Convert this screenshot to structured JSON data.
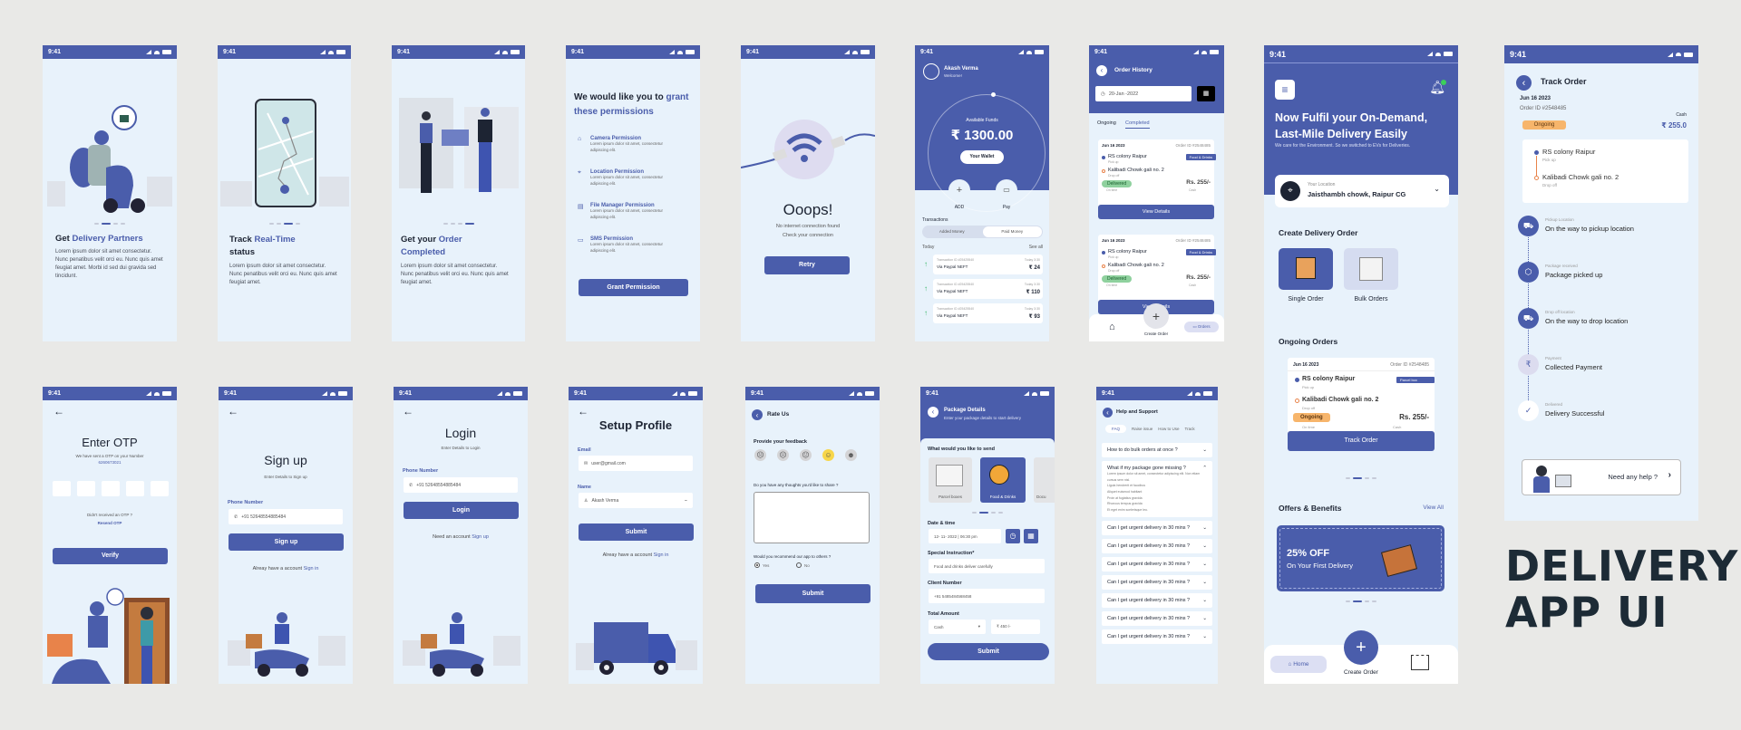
{
  "status_time": "9:41",
  "brand_title": [
    "DELIVERY",
    "APP UI"
  ],
  "colors": {
    "primary": "#4a5dab",
    "screen_bg": "#e8f2fb",
    "page_bg": "#e9e9e7",
    "ongoing": "#f7b56b",
    "delivered": "#8fd19e"
  },
  "onboarding": [
    {
      "title_plain": "Get ",
      "title_accent": "Delivery Partners",
      "body": "Lorem ipsum dolor sit amet consectetur. Nunc penatibus velit orci eu. Nunc quis amet feugiat amet. Morbi id sed dui gravida sed tincidunt."
    },
    {
      "title_plain": "Track ",
      "title_accent": "Real-Time",
      "title_tail": "status",
      "body": "Lorem ipsum dolor sit amet consectetur. Nunc penatibus velit orci eu. Nunc quis amet feugiat amet."
    },
    {
      "title_plain": "Get your ",
      "title_accent": "Order Completed",
      "body": "Lorem ipsum dolor sit amet consectetur. Nunc penatibus velit orci eu. Nunc quis amet feugiat amet."
    }
  ],
  "permissions": {
    "title_plain": "We would like you to ",
    "title_accent": "grant these permissions",
    "items": [
      {
        "icon": "camera-icon",
        "title": "Camera Permission",
        "desc": "Lorem ipsum dolor sit amet, consectetur adipiscing elit."
      },
      {
        "icon": "location-icon",
        "title": "Location Permission",
        "desc": "Lorem ipsum dolor sit amet, consectetur adipiscing elit."
      },
      {
        "icon": "file-icon",
        "title": "File Manager Permission",
        "desc": "Lorem ipsum dolor sit amet, consectetur adipiscing elit."
      },
      {
        "icon": "sms-icon",
        "title": "SMS Permission",
        "desc": "Lorem ipsum dolor sit amet, consectetur adipiscing elit."
      }
    ],
    "button": "Grant Permission"
  },
  "no_internet": {
    "title": "Ooops!",
    "line1": "No internet connection found",
    "line2": "Check your connection",
    "button": "Retry"
  },
  "wallet": {
    "user": "Akash Verma",
    "greeting": "Welcome!",
    "funds_label": "Available Funds",
    "amount": "₹ 1300.00",
    "wallet_btn": "Your Wallet",
    "add": "ADD",
    "pay": "Pay",
    "transactions_label": "Transactions",
    "tabs": [
      "Added Money",
      "Paid Money"
    ],
    "today": "Today",
    "see_all": "See all",
    "items": [
      {
        "id": "Transaction ID #25425540",
        "via": "Via Paypal NEFT",
        "time": "Today 3:30",
        "amount": "₹ 24"
      },
      {
        "id": "Transaction ID #25425540",
        "via": "Via Paypal NEFT",
        "time": "Today 3:30",
        "amount": "₹ 110"
      },
      {
        "id": "Transaction ID #25425540",
        "via": "Via Paypal NEFT",
        "time": "Today 3:30",
        "amount": "₹ 93"
      }
    ]
  },
  "order_history": {
    "title": "Order History",
    "date": "20-Jan -2022",
    "tabs": [
      "Ongoing",
      "Completed"
    ],
    "orders": [
      {
        "date": "Jun 16 2023",
        "order_id": "Order ID #2548485",
        "tag": "Food & Drinks",
        "pickup": "RS colony Raipur",
        "pickup_label": "Pick up",
        "drop": "Kalibadi Chowk gali no. 2",
        "drop_label": "Drop off",
        "status": "Delivered",
        "status_sub": "On time",
        "price": "Rs. 255/-",
        "pay": "Cash",
        "button": "View Details"
      },
      {
        "date": "Jun 16 2023",
        "order_id": "Order ID #2548485",
        "tag": "Food & Drinks",
        "pickup": "RS colony Raipur",
        "pickup_label": "Pick up",
        "drop": "Kalibadi Chowk gali no. 2",
        "drop_label": "Drop off",
        "status": "Delivered",
        "status_sub": "On time",
        "price": "Rs. 255/-",
        "pay": "Cash",
        "button": "View Details"
      }
    ],
    "nav": {
      "create": "Create Order",
      "orders": "Orders"
    }
  },
  "home": {
    "headline": "Now Fulfil your On-Demand, Last-Mile Delivery Easily",
    "sub": "We care for the Environment. So we switched to EVs for Deliveries.",
    "location_label": "Your Location",
    "location": "Jaisthambh chowk, Raipur CG",
    "create_title": "Create Delivery Order",
    "single": "Single Order",
    "bulk": "Bulk Orders",
    "ongoing_title": "Ongoing Orders",
    "order": {
      "date": "Jun 16 2023",
      "order_id": "Order ID #2548485",
      "tag": "Parcel box",
      "pickup": "RS colony Raipur",
      "pickup_label": "Pick up",
      "drop": "Kalibadi Chowk gali no. 2",
      "drop_label": "Drop off",
      "status": "Ongoing",
      "status_sub": "On time",
      "price": "Rs. 255/-",
      "pay": "Cash",
      "button": "Track Order"
    },
    "offers_title": "Offers & Benefits",
    "view_all": "View All",
    "offer_big": "25% OFF",
    "offer_small": "On Your First Delivery",
    "nav": {
      "home": "Home",
      "create": "Create Order"
    }
  },
  "track": {
    "title": "Track Order",
    "date": "Jun 16 2023",
    "order_id": "Order ID #2548485",
    "status": "Ongoing",
    "pay": "Cash",
    "amount": "₹ 255.0",
    "pickup": "RS colony Raipur",
    "pickup_label": "Pick up",
    "drop": "Kalibadi Chowk gali no. 2",
    "drop_label": "Drop off",
    "steps": [
      {
        "label": "Pickup Location",
        "text": "On the way to pickup location",
        "icon": "truck-icon"
      },
      {
        "label": "Package received",
        "text": "Package picked up",
        "icon": "package-icon"
      },
      {
        "label": "Drop off location",
        "text": "On the way to drop location",
        "icon": "truck-icon"
      },
      {
        "label": "Payment",
        "text": "Collected Payment",
        "icon": "rupee-icon"
      },
      {
        "label": "Delivered",
        "text": "Delivery Successful",
        "icon": "check-icon"
      }
    ],
    "help": "Need any help ?"
  },
  "otp": {
    "title": "Enter OTP",
    "sub": "We have sent a OTP on your Number",
    "number": "6260673021",
    "not_received": "Didn't received an OTP ?",
    "resend": "Resend OTP",
    "button": "Verify"
  },
  "signup": {
    "title": "Sign up",
    "sub": "Enter Details to Sign up",
    "phone_label": "Phone Number",
    "phone": "+91 52648554885484",
    "button": "Sign up",
    "footer": "Alreay have a account ",
    "footer_link": "Sign in"
  },
  "login": {
    "title": "Login",
    "sub": "Enter Details to Login",
    "phone_label": "Phone Number",
    "phone": "+91 52648554885484",
    "button": "Login",
    "footer": "Need an account ",
    "footer_link": "Sign up"
  },
  "profile": {
    "title": "Setup Profile",
    "email_label": "Email",
    "email": "user@gmail.com",
    "name_label": "Name",
    "name": "Akash Verma",
    "button": "Submit",
    "footer": "Alreay have a account ",
    "footer_link": "Sign in"
  },
  "rate": {
    "title": "Rate Us",
    "feedback": "Provide your feedback",
    "selected_rating": 4,
    "thoughts": "Do you have any thoughts you'd like to share ?",
    "recommend": "Would you recommend our app to others ?",
    "yes": "Yes",
    "no": "No",
    "button": "Submit"
  },
  "package": {
    "title": "Package Details",
    "sub": "Enter your package details to start delivery",
    "send_title": "What would you like to send",
    "types": [
      "Parcel boxes",
      "Food & Drinks",
      "Docu"
    ],
    "date_label": "Date & time",
    "date": "12- 11- 2022 | 06:30 pm",
    "instr_label": "Special Instruction*",
    "instr": "Food and drinks deliver carefully",
    "client_label": "Client Number",
    "client": "+91 5485484568458",
    "amount_label": "Total Amount",
    "pay_mode": "Cash",
    "amount": "₹ 450 /-",
    "button": "Submit"
  },
  "help": {
    "title": "Help and Support",
    "tabs": [
      "FAQ",
      "Raise issue",
      "How to Use",
      "Track"
    ],
    "faq": [
      {
        "q": "How to do bulk orders at once ?",
        "open": false
      },
      {
        "q": "What if my package gone missing ?",
        "open": true,
        "answer": [
          "Lorem ipsum dolor sit amet, consectetur adipiscing elit. Non etiam cursus sem nisl.",
          "Ligula hendrerit et faucibus",
          "Aliquet euismod habitant",
          "Proin at fugiatius gravida",
          "Rhoncus tempus gravida",
          "Et eget enim scelerisque leo."
        ]
      },
      {
        "q": "Can I get urgent delivery in 30 mins ?",
        "open": false
      },
      {
        "q": "Can I get urgent delivery in 30 mins ?",
        "open": false
      },
      {
        "q": "Can I get urgent delivery in 30 mins ?",
        "open": false
      },
      {
        "q": "Can I get urgent delivery in 30 mins ?",
        "open": false
      },
      {
        "q": "Can I get urgent delivery in 30 mins ?",
        "open": false
      },
      {
        "q": "Can I get urgent delivery in 30 mins ?",
        "open": false
      },
      {
        "q": "Can I get urgent delivery in 30 mins ?",
        "open": false
      }
    ]
  }
}
